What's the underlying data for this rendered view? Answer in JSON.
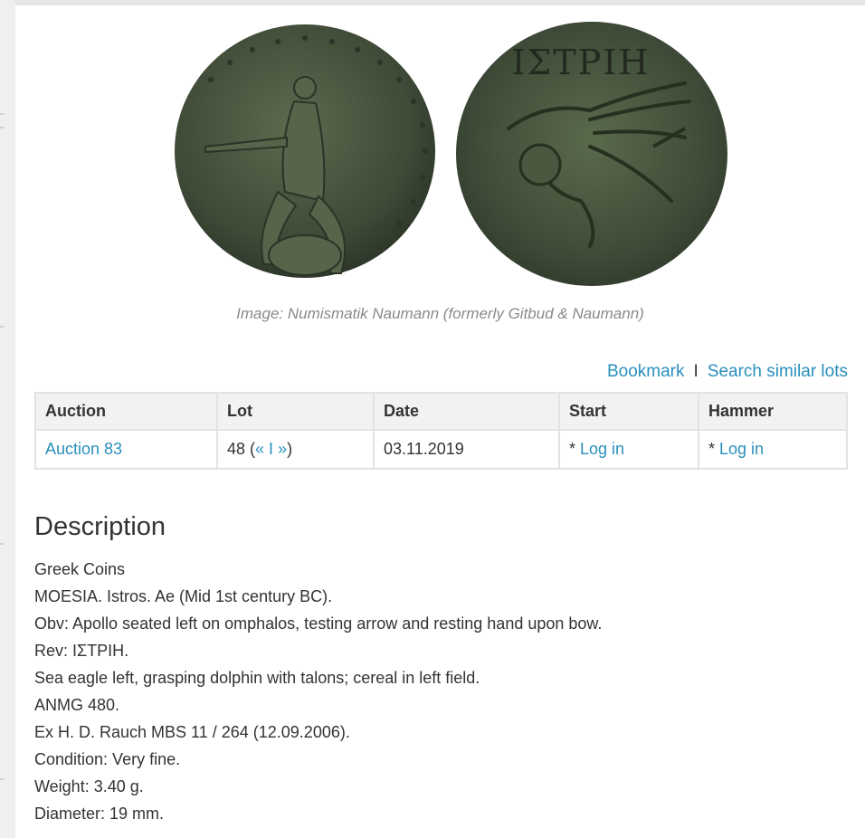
{
  "image": {
    "caption": "Image: Numismatik Naumann (formerly Gitbud & Naumann)",
    "obverse_inscription": "",
    "reverse_inscription": "ΙΣΤΡΙΗ",
    "coin_color": "#3f4a37"
  },
  "actions": {
    "bookmark": "Bookmark",
    "separator": "I",
    "search_similar": "Search similar lots"
  },
  "lots_table": {
    "headers": [
      "Auction",
      "Lot",
      "Date",
      "Start",
      "Hammer"
    ],
    "row": {
      "auction": "Auction 83",
      "lot_number": "48 (",
      "prev": "«",
      "lot_sep": " I ",
      "next": "»",
      "lot_close": ")",
      "date": "03.11.2019",
      "start_prefix": "* ",
      "start_link": "Log in",
      "hammer_prefix": "* ",
      "hammer_link": "Log in"
    }
  },
  "description": {
    "heading": "Description",
    "lines": [
      "Greek Coins",
      "MOESIA. Istros. Ae (Mid 1st century BC).",
      "Obv: Apollo seated left on omphalos, testing arrow and resting hand upon bow.",
      "Rev: ΙΣΤΡΙΗ.",
      "Sea eagle left, grasping dolphin with talons; cereal in left field.",
      "ANMG 480.",
      "Ex H. D. Rauch MBS 11 / 264 (12.09.2006).",
      "Condition: Very fine.",
      "Weight: 3.40 g.",
      "Diameter: 19 mm."
    ]
  },
  "colors": {
    "link": "#2a8fbd",
    "table_header_bg": "#f2f2f2",
    "border": "#e3e3e3"
  }
}
